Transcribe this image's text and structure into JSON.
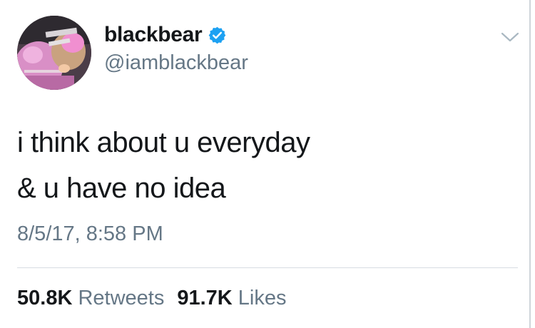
{
  "user": {
    "display_name": "blackbear",
    "handle": "@iamblackbear",
    "verified": true,
    "avatar_icon": "profile-photo"
  },
  "tweet": {
    "lines": [
      "i think about u everyday",
      "& u have no idea"
    ],
    "timestamp": "8/5/17, 8:58 PM"
  },
  "stats": {
    "retweets_count": "50.8K",
    "retweets_label": "Retweets",
    "likes_count": "91.7K",
    "likes_label": "Likes"
  },
  "icons": {
    "verified": "verified-badge-icon",
    "menu": "chevron-down-icon"
  },
  "colors": {
    "verified_blue": "#1da1f2",
    "secondary_text": "#657786",
    "primary_text": "#14171a"
  }
}
